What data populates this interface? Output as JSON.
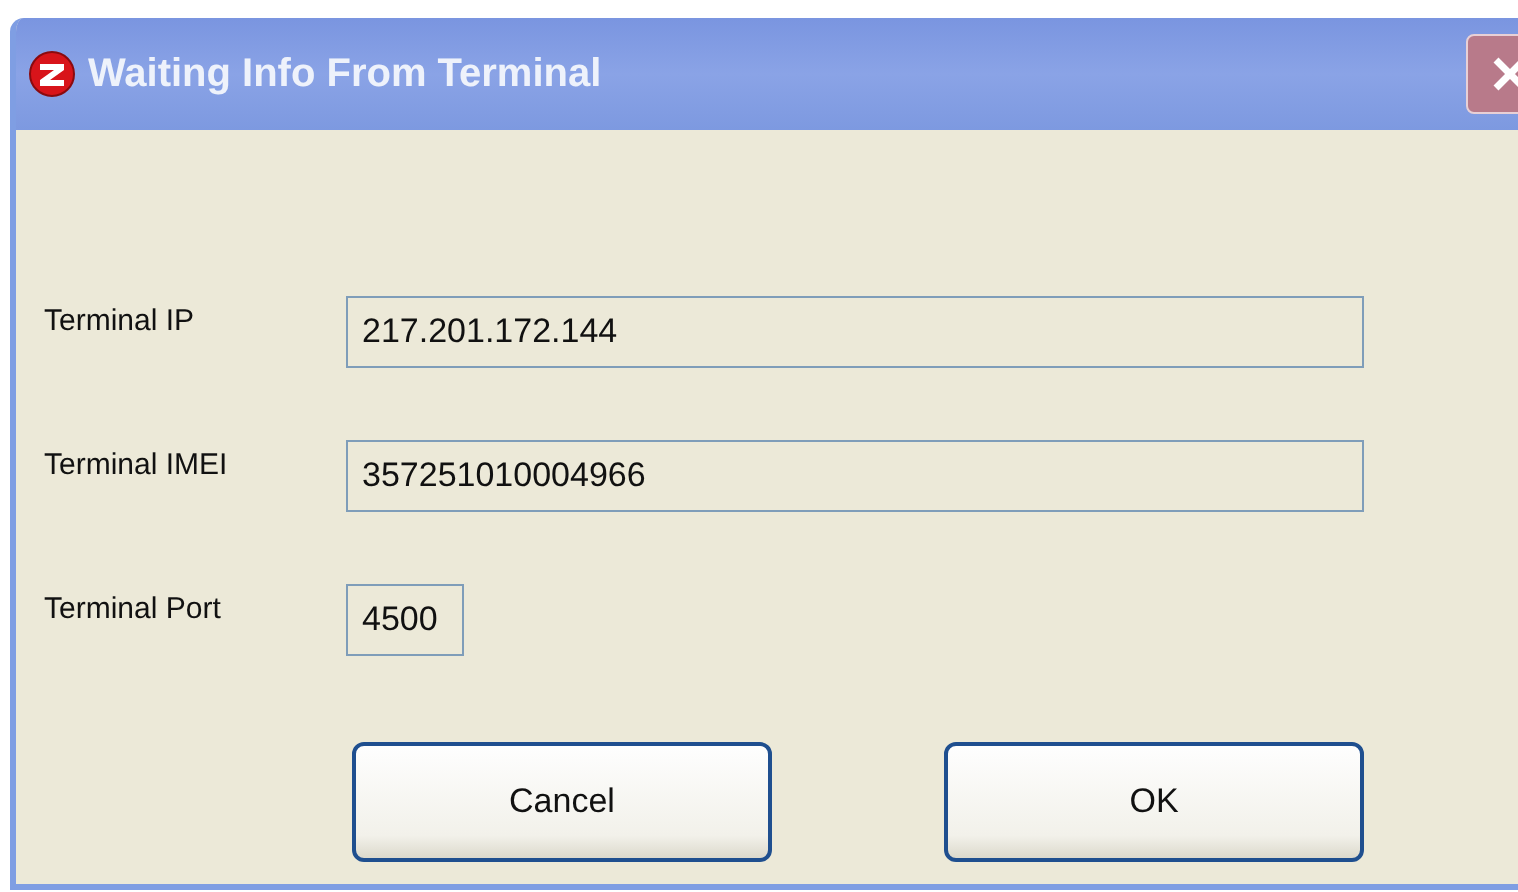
{
  "window": {
    "title": "Waiting Info From Terminal"
  },
  "fields": [
    {
      "label": "Terminal IP",
      "value": "217.201.172.144",
      "kind": "wide"
    },
    {
      "label": "Terminal IMEI",
      "value": "357251010004966",
      "kind": "wide"
    },
    {
      "label": "Terminal Port",
      "value": "4500",
      "kind": "short"
    }
  ],
  "buttons": [
    "Cancel",
    "OK"
  ]
}
